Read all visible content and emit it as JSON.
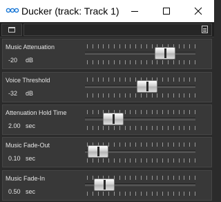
{
  "window": {
    "title": "Ducker (track: Track 1)",
    "icon": "link-icon"
  },
  "params": [
    {
      "label": "Music Attenuation",
      "value": "-20",
      "unit": "dB",
      "slider_fraction": 0.78
    },
    {
      "label": "Voice Threshold",
      "value": "-32",
      "unit": "dB",
      "slider_fraction": 0.58
    },
    {
      "label": "Attenuation Hold Time",
      "value": "2.00",
      "unit": "sec",
      "slider_fraction": 0.2
    },
    {
      "label": "Music Fade-Out",
      "value": "0.10",
      "unit": "sec",
      "slider_fraction": 0.03
    },
    {
      "label": "Music Fade-In",
      "value": "0.50",
      "unit": "sec",
      "slider_fraction": 0.1
    }
  ]
}
